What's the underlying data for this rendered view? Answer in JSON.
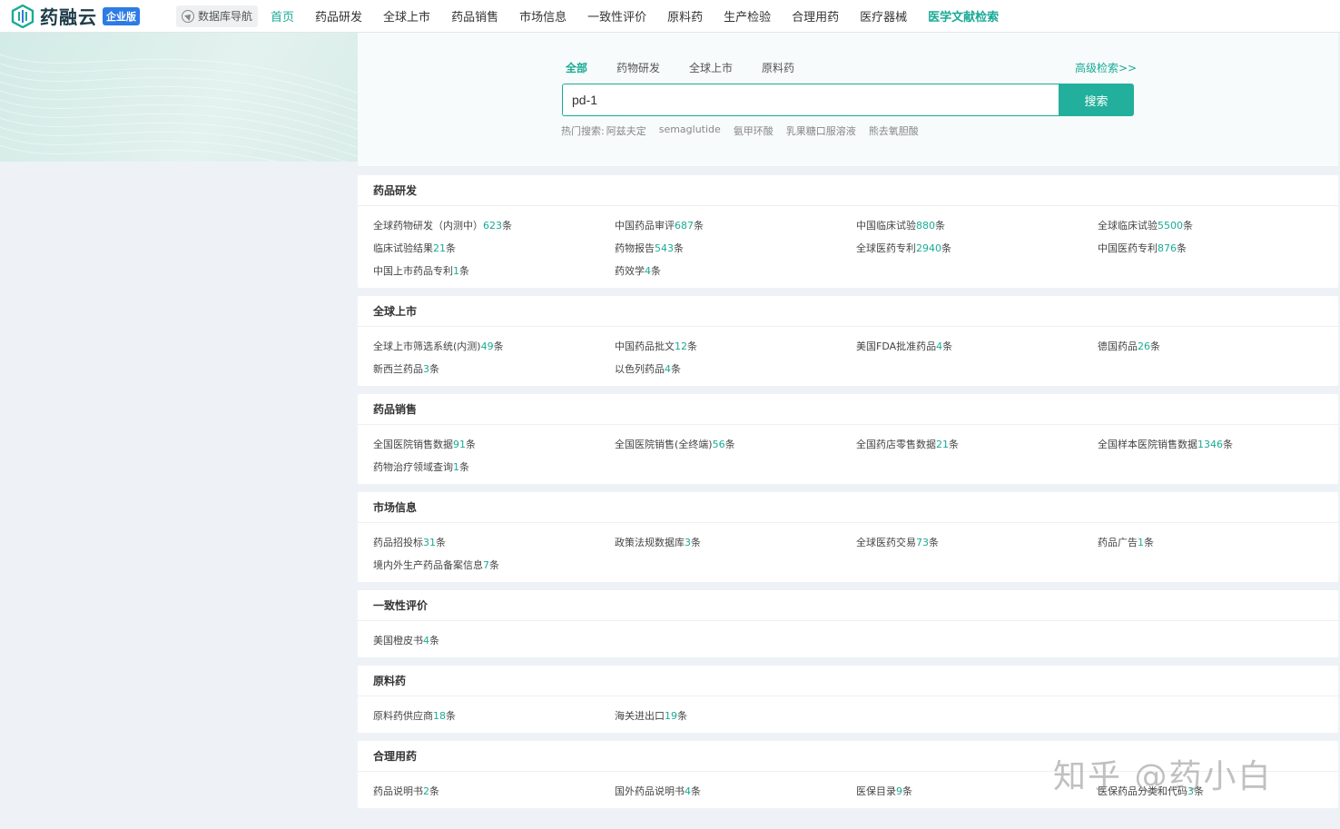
{
  "header": {
    "logo_text": "药融云",
    "logo_badge": "企业版",
    "db_nav_label": "数据库导航",
    "nav": [
      {
        "label": "首页",
        "state": "active"
      },
      {
        "label": "药品研发"
      },
      {
        "label": "全球上市"
      },
      {
        "label": "药品销售"
      },
      {
        "label": "市场信息"
      },
      {
        "label": "一致性评价"
      },
      {
        "label": "原料药"
      },
      {
        "label": "生产检验"
      },
      {
        "label": "合理用药"
      },
      {
        "label": "医疗器械"
      },
      {
        "label": "医学文献检索",
        "state": "highlight"
      }
    ]
  },
  "search": {
    "tabs": [
      {
        "label": "全部",
        "state": "active"
      },
      {
        "label": "药物研发"
      },
      {
        "label": "全球上市"
      },
      {
        "label": "原料药"
      }
    ],
    "advanced_link": "高级检索>>",
    "query": "pd-1",
    "button_label": "搜索",
    "hot_label": "热门搜索:",
    "hot_terms": [
      "阿兹夫定",
      "semaglutide",
      "氨甲环酸",
      "乳果糖口服溶液",
      "熊去氧胆酸"
    ]
  },
  "sections": [
    {
      "title": "药品研发",
      "items": [
        {
          "name": "全球药物研发（内测中）",
          "count": "623",
          "unit": "条"
        },
        {
          "name": "中国药品审评",
          "count": "687",
          "unit": "条"
        },
        {
          "name": "中国临床试验",
          "count": "880",
          "unit": "条"
        },
        {
          "name": "全球临床试验",
          "count": "5500",
          "unit": "条"
        },
        {
          "name": "临床试验结果",
          "count": "21",
          "unit": "条"
        },
        {
          "name": "药物报告",
          "count": "543",
          "unit": "条"
        },
        {
          "name": "全球医药专利",
          "count": "2940",
          "unit": "条"
        },
        {
          "name": "中国医药专利",
          "count": "876",
          "unit": "条"
        },
        {
          "name": "中国上市药品专利",
          "count": "1",
          "unit": "条"
        },
        {
          "name": "药效学",
          "count": "4",
          "unit": "条"
        }
      ]
    },
    {
      "title": "全球上市",
      "items": [
        {
          "name": "全球上市筛选系统(内测)",
          "count": "49",
          "unit": "条"
        },
        {
          "name": "中国药品批文",
          "count": "12",
          "unit": "条"
        },
        {
          "name": "美国FDA批准药品",
          "count": "4",
          "unit": "条"
        },
        {
          "name": "德国药品",
          "count": "26",
          "unit": "条"
        },
        {
          "name": "新西兰药品",
          "count": "3",
          "unit": "条"
        },
        {
          "name": "以色列药品",
          "count": "4",
          "unit": "条"
        }
      ]
    },
    {
      "title": "药品销售",
      "items": [
        {
          "name": "全国医院销售数据",
          "count": "91",
          "unit": "条"
        },
        {
          "name": "全国医院销售(全终端)",
          "count": "56",
          "unit": "条"
        },
        {
          "name": "全国药店零售数据",
          "count": "21",
          "unit": "条"
        },
        {
          "name": "全国样本医院销售数据",
          "count": "1346",
          "unit": "条"
        },
        {
          "name": "药物治疗领域查询",
          "count": "1",
          "unit": "条"
        }
      ]
    },
    {
      "title": "市场信息",
      "items": [
        {
          "name": "药品招投标",
          "count": "31",
          "unit": "条"
        },
        {
          "name": "政策法规数据库",
          "count": "3",
          "unit": "条"
        },
        {
          "name": "全球医药交易",
          "count": "73",
          "unit": "条"
        },
        {
          "name": "药品广告",
          "count": "1",
          "unit": "条"
        },
        {
          "name": "境内外生产药品备案信息",
          "count": "7",
          "unit": "条"
        }
      ]
    },
    {
      "title": "一致性评价",
      "items": [
        {
          "name": "美国橙皮书",
          "count": "4",
          "unit": "条"
        }
      ]
    },
    {
      "title": "原料药",
      "items": [
        {
          "name": "原料药供应商",
          "count": "18",
          "unit": "条"
        },
        {
          "name": "海关进出口",
          "count": "19",
          "unit": "条"
        }
      ]
    },
    {
      "title": "合理用药",
      "items": [
        {
          "name": "药品说明书",
          "count": "2",
          "unit": "条"
        },
        {
          "name": "国外药品说明书",
          "count": "4",
          "unit": "条"
        },
        {
          "name": "医保目录",
          "count": "9",
          "unit": "条"
        },
        {
          "name": "医保药品分类和代码",
          "count": "3",
          "unit": "条"
        }
      ]
    }
  ],
  "watermark": "知乎 @药小白",
  "colors": {
    "accent": "#1aaa96",
    "badge": "#2d7be5",
    "button": "#22b09c"
  }
}
